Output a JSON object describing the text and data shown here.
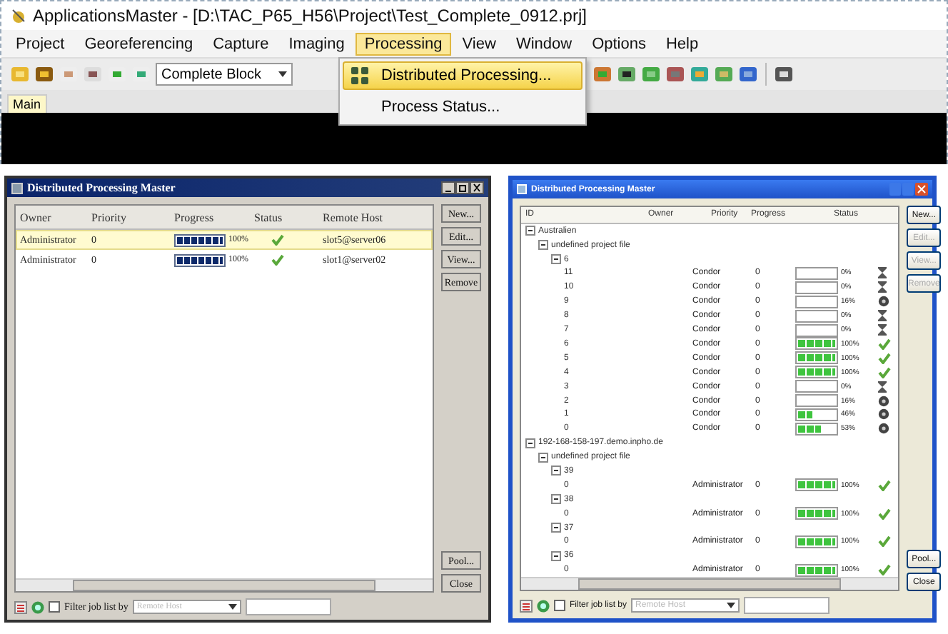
{
  "app": {
    "title": "ApplicationsMaster - [D:\\TAC_P65_H56\\Project\\Test_Complete_0912.prj]",
    "menu": [
      {
        "label": "Project",
        "selected": false
      },
      {
        "label": "Georeferencing",
        "selected": false
      },
      {
        "label": "Capture",
        "selected": false
      },
      {
        "label": "Imaging",
        "selected": false
      },
      {
        "label": "Processing",
        "selected": true
      },
      {
        "label": "View",
        "selected": false
      },
      {
        "label": "Window",
        "selected": false
      },
      {
        "label": "Options",
        "selected": false
      },
      {
        "label": "Help",
        "selected": false
      }
    ],
    "block_select": "Complete Block",
    "tabs": [
      {
        "label": "Main",
        "selected": true
      }
    ],
    "dropdown": [
      {
        "label": "Distributed Processing...",
        "selected": true
      },
      {
        "label": "Process Status...",
        "selected": false
      }
    ]
  },
  "classic_dialog": {
    "title": "Distributed Processing Master",
    "columns": [
      "Owner",
      "Priority",
      "Progress",
      "Status",
      "Remote Host"
    ],
    "rows": [
      {
        "owner": "Administrator",
        "priority": "0",
        "level": 1,
        "percent": "100%",
        "kind": "done",
        "host": "slot5@server06",
        "selected": true
      },
      {
        "owner": "Administrator",
        "priority": "0",
        "level": 1,
        "percent": "100%",
        "kind": "done",
        "host": "slot1@server02",
        "selected": false
      }
    ],
    "buttons": [
      {
        "label": "New...",
        "disabled": false
      },
      {
        "label": "Edit...",
        "disabled": false
      },
      {
        "label": "View...",
        "disabled": false
      },
      {
        "label": "Remove",
        "disabled": false
      }
    ],
    "bottom_buttons": [
      {
        "label": "Pool...",
        "disabled": false
      },
      {
        "label": "Close",
        "disabled": false
      }
    ],
    "filter": {
      "label": "Filter job list by",
      "checked": false,
      "select": "Remote Host",
      "select_disabled": true
    }
  },
  "xp_dialog": {
    "title": "Distributed Processing Master",
    "columns": [
      "ID",
      "Owner",
      "Priority",
      "Progress",
      "Status"
    ],
    "tree": [
      {
        "label": "Australien",
        "expanded": true,
        "children": [
          {
            "label": "undefined project file",
            "expanded": true,
            "children": [
              {
                "label": "6",
                "expanded": true,
                "children": [
                  {
                    "label": "11",
                    "owner": "Condor",
                    "priority": "0",
                    "level": 0,
                    "percent": "0%",
                    "kind": "waiting"
                  },
                  {
                    "label": "10",
                    "owner": "Condor",
                    "priority": "0",
                    "level": 0,
                    "percent": "0%",
                    "kind": "waiting"
                  },
                  {
                    "label": "9",
                    "owner": "Condor",
                    "priority": "0",
                    "level": 0,
                    "percent": "16%",
                    "kind": "running"
                  },
                  {
                    "label": "8",
                    "owner": "Condor",
                    "priority": "0",
                    "level": 0,
                    "percent": "0%",
                    "kind": "waiting"
                  },
                  {
                    "label": "7",
                    "owner": "Condor",
                    "priority": "0",
                    "level": 0,
                    "percent": "0%",
                    "kind": "waiting"
                  },
                  {
                    "label": "6",
                    "owner": "Condor",
                    "priority": "0",
                    "level": 1,
                    "percent": "100%",
                    "kind": "done"
                  },
                  {
                    "label": "5",
                    "owner": "Condor",
                    "priority": "0",
                    "level": 1,
                    "percent": "100%",
                    "kind": "done"
                  },
                  {
                    "label": "4",
                    "owner": "Condor",
                    "priority": "0",
                    "level": 1,
                    "percent": "100%",
                    "kind": "done"
                  },
                  {
                    "label": "3",
                    "owner": "Condor",
                    "priority": "0",
                    "level": 0,
                    "percent": "0%",
                    "kind": "waiting"
                  },
                  {
                    "label": "2",
                    "owner": "Condor",
                    "priority": "0",
                    "level": 0,
                    "percent": "16%",
                    "kind": "running"
                  },
                  {
                    "label": "1",
                    "owner": "Condor",
                    "priority": "0",
                    "level": 0.4,
                    "percent": "46%",
                    "kind": "running"
                  },
                  {
                    "label": "0",
                    "owner": "Condor",
                    "priority": "0",
                    "level": 0.6,
                    "percent": "53%",
                    "kind": "running"
                  }
                ]
              }
            ]
          }
        ]
      },
      {
        "label": "192-168-158-197.demo.inpho.de",
        "expanded": true,
        "children": [
          {
            "label": "undefined project file",
            "expanded": true,
            "children": [
              {
                "label": "39",
                "expanded": true,
                "children": [
                  {
                    "label": "0",
                    "owner": "Administrator",
                    "priority": "0",
                    "level": 1,
                    "percent": "100%",
                    "kind": "done"
                  }
                ]
              },
              {
                "label": "38",
                "expanded": true,
                "children": [
                  {
                    "label": "0",
                    "owner": "Administrator",
                    "priority": "0",
                    "level": 1,
                    "percent": "100%",
                    "kind": "done"
                  }
                ]
              },
              {
                "label": "37",
                "expanded": true,
                "children": [
                  {
                    "label": "0",
                    "owner": "Administrator",
                    "priority": "0",
                    "level": 1,
                    "percent": "100%",
                    "kind": "done"
                  }
                ]
              },
              {
                "label": "36",
                "expanded": true,
                "children": [
                  {
                    "label": "0",
                    "owner": "Administrator",
                    "priority": "0",
                    "level": 1,
                    "percent": "100%",
                    "kind": "done"
                  }
                ]
              }
            ]
          }
        ]
      }
    ],
    "buttons": [
      {
        "label": "New...",
        "disabled": false
      },
      {
        "label": "Edit...",
        "disabled": true
      },
      {
        "label": "View...",
        "disabled": true
      },
      {
        "label": "Remove",
        "disabled": true
      }
    ],
    "bottom_buttons": [
      {
        "label": "Pool...",
        "disabled": false
      },
      {
        "label": "Close",
        "disabled": false
      }
    ],
    "filter": {
      "label": "Filter job list by",
      "checked": false,
      "select": "Remote Host",
      "select_disabled": true
    }
  }
}
